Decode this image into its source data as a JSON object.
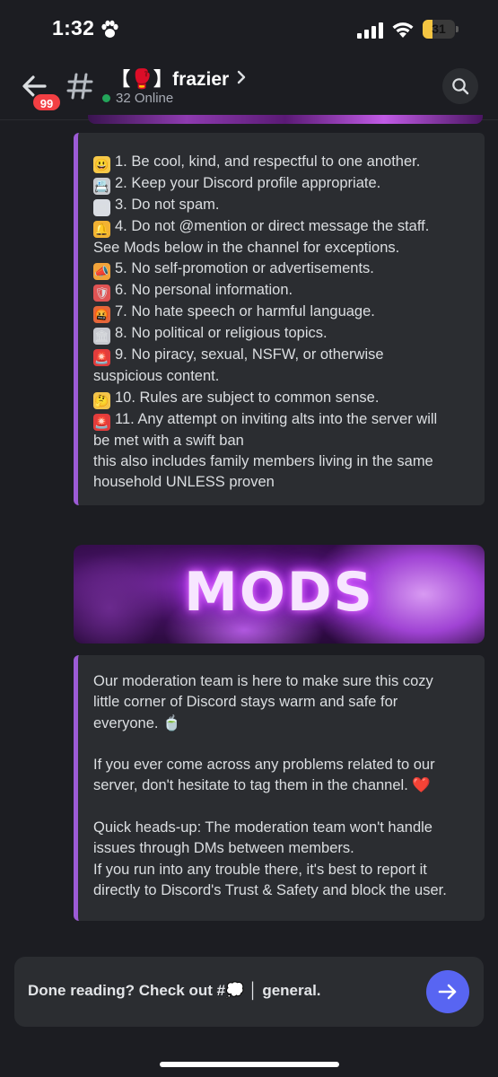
{
  "status_bar": {
    "time": "1:32",
    "battery_text": "31",
    "battery_level_percent": 31,
    "icons": [
      "paw-icon",
      "signal-icon",
      "wifi-icon",
      "battery-icon"
    ]
  },
  "header": {
    "back_icon": "arrow-left-icon",
    "unread_badge": "99",
    "channel_icon": "hash-icon",
    "channel_title": "【🥊】frazier",
    "online_count": "32 Online",
    "search_icon": "search-icon"
  },
  "rules": {
    "lines": [
      {
        "emoji": "😃",
        "emoji_color": "#f7c948",
        "text": "1. Be cool, kind, and respectful to one another."
      },
      {
        "emoji": "📇",
        "emoji_color": "#c9ccd1",
        "text": "2. Keep your Discord profile appropriate."
      },
      {
        "emoji": "✉",
        "emoji_color": "#d9dde3",
        "text": "3. Do not spam."
      },
      {
        "emoji": "🔔",
        "emoji_color": "#f2b233",
        "text": "4. Do not @mention or direct message the staff."
      },
      {
        "emoji": "",
        "emoji_color": "",
        "text": "See Mods below in the channel for exceptions."
      },
      {
        "emoji": "📣",
        "emoji_color": "#f2a33a",
        "text": "5. No self-promotion or advertisements."
      },
      {
        "emoji": "🛡",
        "emoji_color": "#e05353",
        "text": "6. No personal information."
      },
      {
        "emoji": "🤬",
        "emoji_color": "#e5663a",
        "text": "7. No hate speech or harmful language."
      },
      {
        "emoji": "🏛",
        "emoji_color": "#c7c9cf",
        "text": "8. No political or religious topics."
      },
      {
        "emoji": "🚨",
        "emoji_color": "#e23c3c",
        "text": "9. No piracy, sexual, NSFW, or otherwise"
      },
      {
        "emoji": "",
        "emoji_color": "",
        "text": "suspicious content."
      },
      {
        "emoji": "🤔",
        "emoji_color": "#f3c44a",
        "text": "10. Rules are subject to common sense."
      },
      {
        "emoji": "🚨",
        "emoji_color": "#e23c3c",
        "text": "11. Any attempt on inviting alts into the server will"
      },
      {
        "emoji": "",
        "emoji_color": "",
        "text": "be met with a swift ban"
      },
      {
        "emoji": "",
        "emoji_color": "",
        "text": "this also includes family members living in the same"
      },
      {
        "emoji": "",
        "emoji_color": "",
        "text": "household UNLESS proven"
      }
    ]
  },
  "mods_banner": {
    "title": "MODS"
  },
  "mods": {
    "p1": [
      "Our moderation team is here to make sure this cozy",
      "little corner of Discord stays warm and safe for",
      "everyone. 🍵"
    ],
    "p2": [
      "If you ever come across any problems related to our",
      "server, don't hesitate to tag them in the channel. ❤️"
    ],
    "p3": [
      "Quick heads-up: The moderation team won't handle",
      "issues through DMs between members.",
      "If you run into any trouble there, it's best to report it",
      "directly to Discord's Trust & Safety and block the user."
    ]
  },
  "input": {
    "text": "Done reading? Check out #💭 │ general.",
    "send_icon": "arrow-right-icon"
  },
  "colors": {
    "accent": "#5865f2",
    "embed_border": "#9c5bd6",
    "online": "#23a55a",
    "badge": "#f23f43"
  }
}
